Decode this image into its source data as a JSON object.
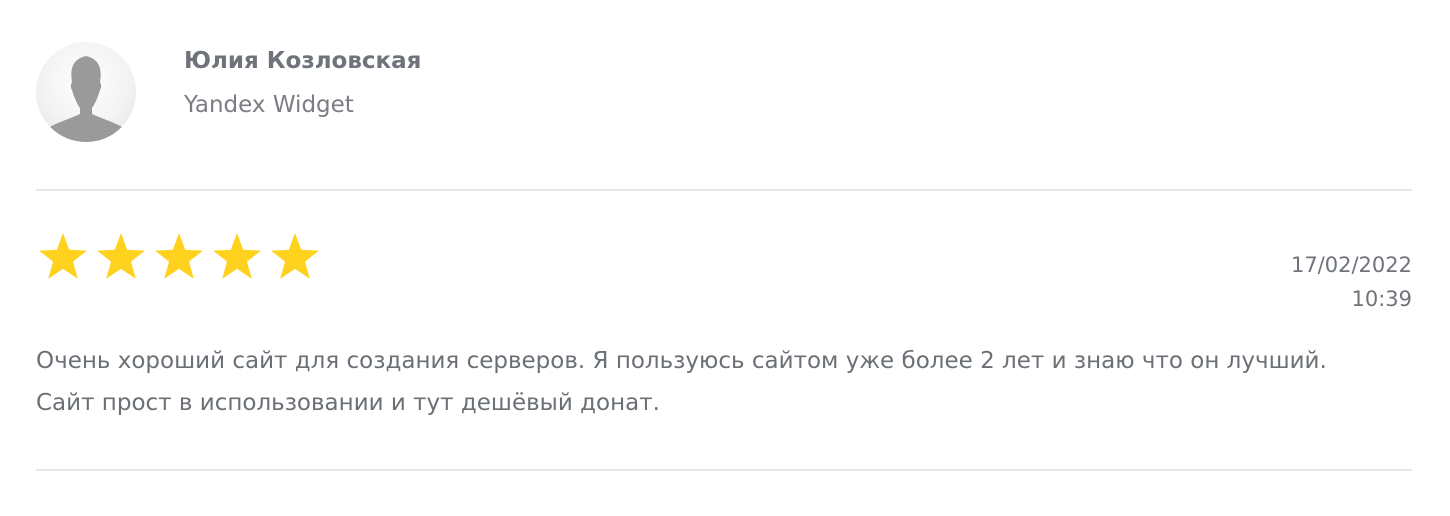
{
  "review": {
    "author": {
      "name": "Юлия Козловская",
      "source": "Yandex Widget",
      "avatar_icon": "user-silhouette-icon"
    },
    "rating": {
      "value": 5,
      "max": 5,
      "star_color": "#FFD21F",
      "star_icon": "star-icon"
    },
    "date": "17/02/2022",
    "time": "10:39",
    "text": "Очень хороший сайт для создания серверов. Я пользуюсь сайтом уже более 2 лет и знаю что он лучший. Сайт прост в использовании и тут дешёвый донат."
  },
  "colors": {
    "divider": "#E6E6E8",
    "text": "#6B7076"
  }
}
